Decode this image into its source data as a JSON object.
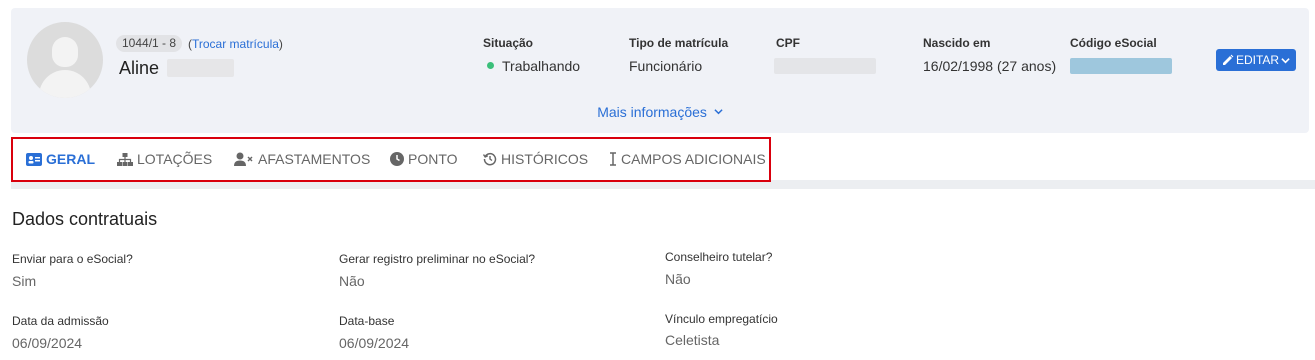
{
  "employee": {
    "registration": "1044/1 - 8",
    "change_link": "Trocar matrícula",
    "name": "Aline"
  },
  "fields": {
    "situation_label": "Situação",
    "situation_value": "Trabalhando",
    "type_label": "Tipo de matrícula",
    "type_value": "Funcionário",
    "cpf_label": "CPF",
    "born_label": "Nascido em",
    "born_value": "16/02/1998 (27 anos)",
    "esocial_label": "Código eSocial"
  },
  "actions": {
    "edit_label": "EDITAR",
    "more_info": "Mais informações"
  },
  "tabs": [
    {
      "label": "GERAL",
      "icon": "id-card-icon"
    },
    {
      "label": "LOTAÇÕES",
      "icon": "sitemap-icon"
    },
    {
      "label": "AFASTAMENTOS",
      "icon": "user-x-icon"
    },
    {
      "label": "PONTO",
      "icon": "clock-icon"
    },
    {
      "label": "HISTÓRICOS",
      "icon": "history-icon"
    },
    {
      "label": "CAMPOS ADICIONAIS",
      "icon": "text-cursor-icon"
    }
  ],
  "section": {
    "title": "Dados contratuais",
    "items": [
      {
        "label": "Enviar para o eSocial?",
        "value": "Sim"
      },
      {
        "label": "Gerar registro preliminar no eSocial?",
        "value": "Não"
      },
      {
        "label": "Conselheiro tutelar?",
        "value": "Não"
      },
      {
        "label": "Data da admissão",
        "value": "06/09/2024"
      },
      {
        "label": "Data-base",
        "value": "06/09/2024"
      },
      {
        "label": "Vínculo empregatício",
        "value": "Celetista"
      }
    ]
  },
  "colors": {
    "accent": "#2a6fd6",
    "status_active": "#3bbf7a",
    "highlight_border": "#d9000d"
  }
}
